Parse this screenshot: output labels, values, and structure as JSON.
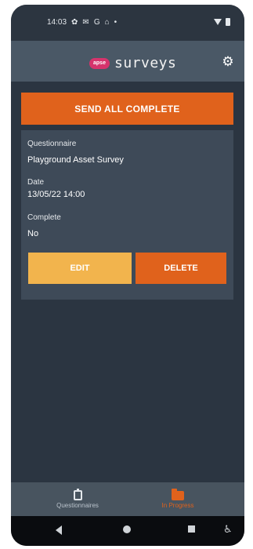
{
  "status_bar": {
    "time": "14:03",
    "left_icons": [
      "settings-icon",
      "mail-icon",
      "google-icon",
      "ticket-icon",
      "dot-icon"
    ],
    "right_icons": [
      "wifi-icon",
      "battery-icon"
    ]
  },
  "header": {
    "logo_badge": "apse",
    "app_name": "surveys",
    "settings_icon": "gear-icon"
  },
  "main": {
    "send_all_label": "SEND ALL COMPLETE",
    "survey": {
      "questionnaire_label": "Questionnaire",
      "questionnaire_value": "Playground Asset Survey",
      "date_label": "Date",
      "date_value": "13/05/22 14:00",
      "complete_label": "Complete",
      "complete_value": "No",
      "edit_label": "EDIT",
      "delete_label": "DELETE"
    }
  },
  "bottom_nav": {
    "items": [
      {
        "label": "Questionnaires",
        "icon": "clipboard-icon",
        "active": false
      },
      {
        "label": "In Progress",
        "icon": "folder-icon",
        "active": true
      }
    ]
  },
  "system_nav": {
    "icons": [
      "back-icon",
      "home-icon",
      "recents-icon",
      "accessibility-icon"
    ]
  },
  "colors": {
    "accent_orange": "#e0621c",
    "edit_yellow": "#f2b44d",
    "header_bg": "#4a5866",
    "content_bg": "#2b3541",
    "card_bg": "#3e4a58",
    "logo_badge": "#d6336c"
  }
}
